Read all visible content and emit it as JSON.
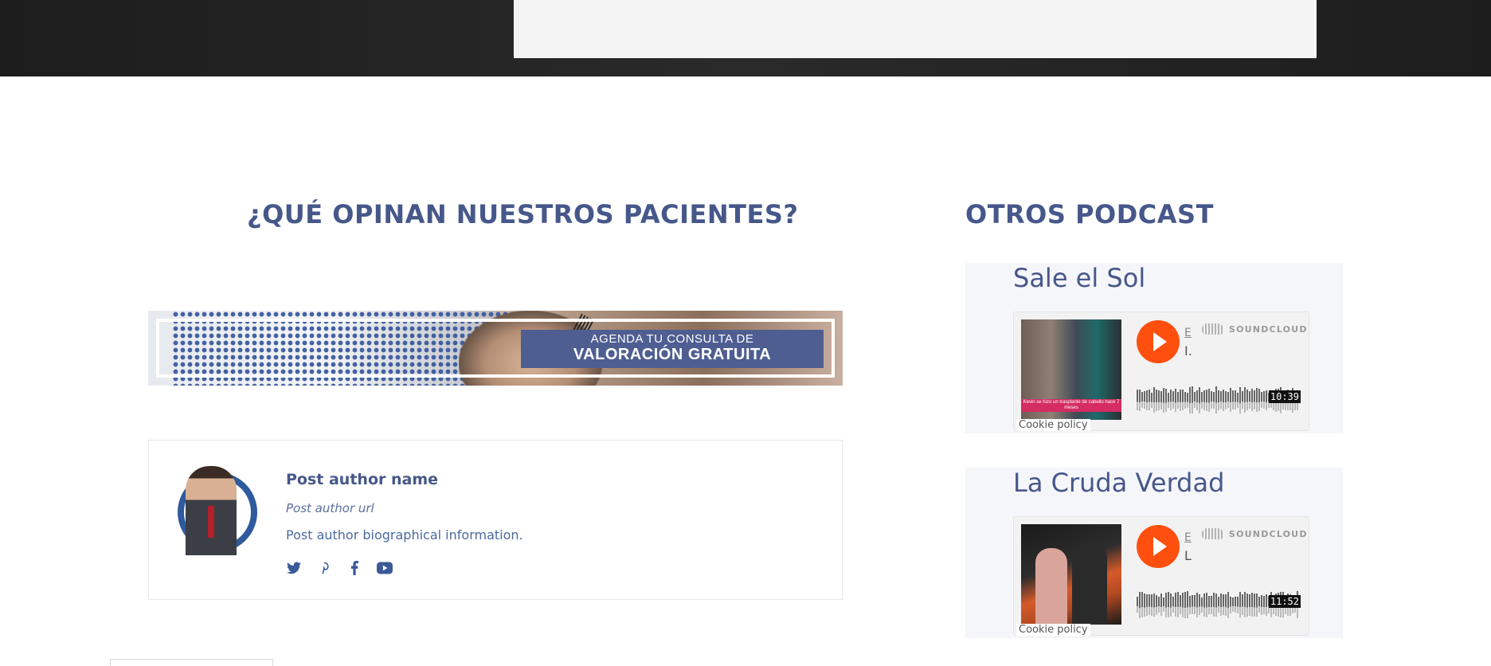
{
  "left_section": {
    "title": "¿QUÉ OPINAN NUESTROS PACIENTES?",
    "banner": {
      "line1": "AGENDA TU CONSULTA DE",
      "line2": "VALORACIÓN GRATUITA"
    },
    "author": {
      "name": "Post author name",
      "url": "Post author url",
      "bio": "Post author biographical information.",
      "socials": [
        {
          "icon": "twitter-icon",
          "glyph": "🐦"
        },
        {
          "icon": "pinterest-icon",
          "glyph": "𝓅"
        },
        {
          "icon": "facebook-icon",
          "glyph": "f"
        },
        {
          "icon": "youtube-icon",
          "glyph": "▶"
        }
      ]
    }
  },
  "right_section": {
    "title": "OTROS PODCAST",
    "podcasts": [
      {
        "title": "Sale el Sol",
        "artist": "E",
        "track": "I.",
        "brand": "SOUNDCLOUD",
        "duration": "10:39",
        "thumb_caption": "Kevin se hizo un trasplante de cabello hace 7 meses",
        "cookie": "Cookie policy"
      },
      {
        "title": "La Cruda Verdad",
        "artist": "E",
        "track": "L",
        "brand": "SOUNDCLOUD",
        "duration": "11:52",
        "cookie": "Cookie policy"
      }
    ]
  },
  "colors": {
    "accent": "#46578a",
    "soundcloud": "#ff4f0f",
    "banner_box": "#4f5e91"
  }
}
